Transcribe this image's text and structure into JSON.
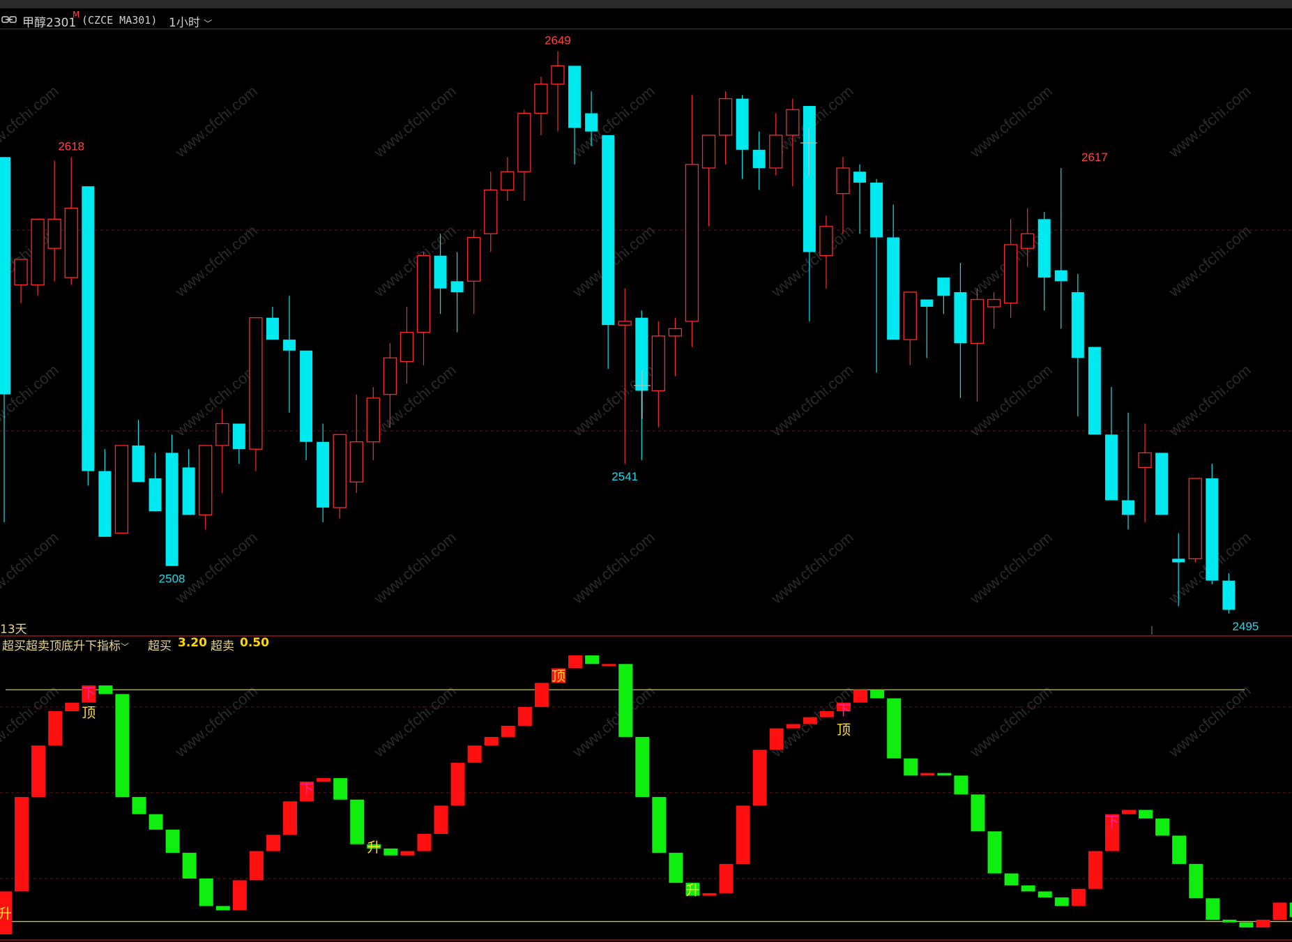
{
  "window": {
    "symbol": "甲醇2301",
    "superscript": "M",
    "exchange_code": "(CZCE MA301)",
    "period": "1小时"
  },
  "colors": {
    "up": "#ff2a2a",
    "down": "#00e8f0",
    "ind_up": "#ff1010",
    "ind_down": "#10ee10",
    "bg": "#000000"
  },
  "price_chart": {
    "price_axis_range": [
      2490,
      2655
    ],
    "candles": [
      [
        2620,
        2618,
        2520,
        2555
      ],
      [
        2585,
        2592,
        2580,
        2592
      ],
      [
        2585,
        2603,
        2582,
        2603
      ],
      [
        2595,
        2619,
        2586,
        2603
      ],
      [
        2587,
        2620,
        2585,
        2606
      ],
      [
        2612,
        2612,
        2530,
        2534
      ],
      [
        2534,
        2540,
        2525,
        2516
      ],
      [
        2517,
        2541,
        2517,
        2541
      ],
      [
        2541,
        2548,
        2533,
        2531
      ],
      [
        2532,
        2539,
        2524,
        2523
      ],
      [
        2539,
        2544,
        2508,
        2508
      ],
      [
        2535,
        2540,
        2524,
        2522
      ],
      [
        2522,
        2541,
        2518,
        2541
      ],
      [
        2541,
        2551,
        2528,
        2547
      ],
      [
        2547,
        2547,
        2536,
        2540
      ],
      [
        2540,
        2576,
        2534,
        2576
      ],
      [
        2576,
        2579,
        2570,
        2570
      ],
      [
        2570,
        2582,
        2550,
        2567
      ],
      [
        2567,
        2567,
        2537,
        2542
      ],
      [
        2542,
        2547,
        2520,
        2524
      ],
      [
        2524,
        2544,
        2521,
        2544
      ],
      [
        2531,
        2555,
        2528,
        2542
      ],
      [
        2542,
        2557,
        2537,
        2554
      ],
      [
        2555,
        2569,
        2546,
        2565
      ],
      [
        2564,
        2579,
        2558,
        2572
      ],
      [
        2572,
        2594,
        2563,
        2593
      ],
      [
        2593,
        2599,
        2577,
        2584
      ],
      [
        2586,
        2594,
        2572,
        2583
      ],
      [
        2586,
        2600,
        2577,
        2598
      ],
      [
        2599,
        2616,
        2594,
        2611
      ],
      [
        2611,
        2620,
        2608,
        2616
      ],
      [
        2616,
        2633,
        2608,
        2632
      ],
      [
        2632,
        2642,
        2626,
        2640
      ],
      [
        2640,
        2649,
        2627,
        2645
      ],
      [
        2645,
        2645,
        2618,
        2628
      ],
      [
        2632,
        2638,
        2623,
        2627
      ],
      [
        2626,
        2626,
        2562,
        2574
      ],
      [
        2574,
        2584,
        2536,
        2575
      ],
      [
        2576,
        2578,
        2537,
        2556
      ],
      [
        2556,
        2575,
        2546,
        2571
      ],
      [
        2571,
        2576,
        2560,
        2573
      ],
      [
        2575,
        2637,
        2568,
        2618
      ],
      [
        2617,
        2622,
        2601,
        2626
      ],
      [
        2626,
        2638,
        2618,
        2636
      ],
      [
        2636,
        2637,
        2614,
        2622
      ],
      [
        2622,
        2627,
        2611,
        2617
      ],
      [
        2617,
        2632,
        2615,
        2626
      ],
      [
        2626,
        2636,
        2612,
        2633
      ],
      [
        2634,
        2633,
        2575,
        2594
      ],
      [
        2593,
        2604,
        2584,
        2601
      ],
      [
        2610,
        2620,
        2599,
        2617
      ],
      [
        2616,
        2618,
        2599,
        2613
      ],
      [
        2613,
        2614,
        2561,
        2598
      ],
      [
        2598,
        2607,
        2570,
        2570
      ],
      [
        2570,
        2578,
        2563,
        2583
      ],
      [
        2581,
        2580,
        2565,
        2579
      ],
      [
        2587,
        2587,
        2577,
        2582
      ],
      [
        2583,
        2591,
        2554,
        2569
      ],
      [
        2569,
        2584,
        2553,
        2581
      ],
      [
        2579,
        2583,
        2573,
        2581
      ],
      [
        2580,
        2603,
        2576,
        2596
      ],
      [
        2595,
        2606,
        2590,
        2599
      ],
      [
        2603,
        2605,
        2578,
        2587
      ],
      [
        2589,
        2617,
        2573,
        2586
      ],
      [
        2583,
        2588,
        2549,
        2565
      ],
      [
        2568,
        2568,
        2552,
        2544
      ],
      [
        2544,
        2557,
        2528,
        2526
      ],
      [
        2526,
        2550,
        2518,
        2522
      ],
      [
        2535,
        2547,
        2520,
        2539
      ],
      [
        2539,
        2538,
        2522,
        2522
      ],
      [
        2510,
        2517,
        2497,
        2509
      ],
      [
        2510,
        2531,
        2509,
        2532
      ],
      [
        2532,
        2536,
        2503,
        2504
      ],
      [
        2504,
        2506,
        2495,
        2496
      ]
    ],
    "marks": [
      {
        "label": "2618",
        "idx": 4,
        "price": 2620,
        "color": "#ff4444"
      },
      {
        "label": "2508",
        "idx": 10,
        "price": 2508,
        "color": "#22d8e8"
      },
      {
        "label": "2649",
        "idx": 33,
        "price": 2649,
        "color": "#ff4444"
      },
      {
        "label": "2541",
        "idx": 37,
        "price": 2536,
        "color": "#22d8e8"
      },
      {
        "label": "2617",
        "idx": 65,
        "price": 2617,
        "color": "#ff4444"
      },
      {
        "label": "2495",
        "idx": 74,
        "price": 2495,
        "color": "#22d8e8"
      }
    ],
    "period_label": "13天"
  },
  "indicator": {
    "name": "超买超卖顶底升下指标",
    "overbought_label": "超买",
    "overbought_value": "3.20",
    "oversold_label": "超卖",
    "oversold_value": "0.50",
    "value_range": [
      0.35,
      3.6
    ],
    "values": [
      0.85,
      1.95,
      2.55,
      2.95,
      3.05,
      3.25,
      3.15,
      1.95,
      1.75,
      1.57,
      1.3,
      1.0,
      0.68,
      0.63,
      0.98,
      1.32,
      1.51,
      1.9,
      2.13,
      2.17,
      1.92,
      1.4,
      1.35,
      1.27,
      1.32,
      1.52,
      1.85,
      2.35,
      2.55,
      2.65,
      2.78,
      3.0,
      3.28,
      3.45,
      3.6,
      3.5,
      3.5,
      2.65,
      1.95,
      1.3,
      0.95,
      0.8,
      0.83,
      1.17,
      1.85,
      2.5,
      2.75,
      2.8,
      2.88,
      2.95,
      3.05,
      3.2,
      3.1,
      2.4,
      2.2,
      2.23,
      2.2,
      1.98,
      1.55,
      1.06,
      0.92,
      0.85,
      0.78,
      0.68,
      0.88,
      1.32,
      1.75,
      1.8,
      1.7,
      1.5,
      1.17,
      0.77,
      0.52,
      0.49,
      0.43,
      0.52,
      0.72,
      0.55,
      0.52
    ],
    "signals": [
      {
        "idx": 0,
        "text": "升",
        "color": "#ffdd22",
        "pos": "mid"
      },
      {
        "idx": 5,
        "text": "下",
        "color": "#ff2299",
        "pos": "top"
      },
      {
        "idx": 5,
        "text": "顶",
        "color": "#ffdd22",
        "pos": "top2"
      },
      {
        "idx": 18,
        "text": "下",
        "color": "#ff2299",
        "pos": "top"
      },
      {
        "idx": 22,
        "text": "升",
        "color": "#ffdd22",
        "pos": "mid"
      },
      {
        "idx": 33,
        "text": "顶",
        "color": "#ffdd22",
        "pos": "top"
      },
      {
        "idx": 41,
        "text": "升",
        "color": "#ffdd22",
        "pos": "mid"
      },
      {
        "idx": 50,
        "text": "下",
        "color": "#ff2299",
        "pos": "top"
      },
      {
        "idx": 50,
        "text": "顶",
        "color": "#ffdd22",
        "pos": "top2"
      },
      {
        "idx": 66,
        "text": "下",
        "color": "#ff2299",
        "pos": "top"
      }
    ],
    "watermark": "www.cfchi.com"
  }
}
